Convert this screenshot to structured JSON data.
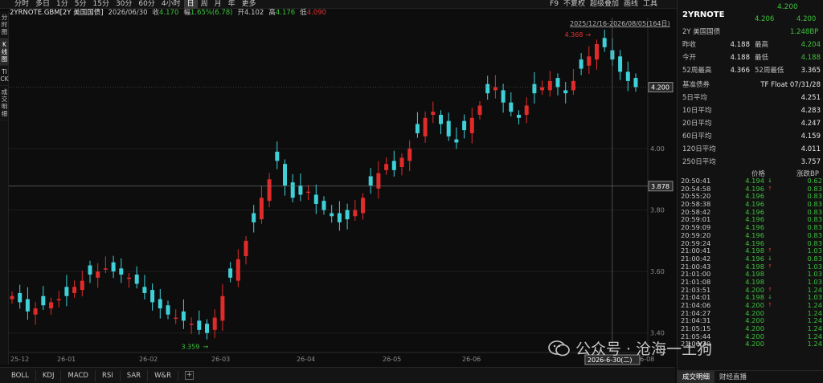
{
  "toolbar": {
    "periods": [
      "分时",
      "多日",
      "1分",
      "5分",
      "15分",
      "30分",
      "60分",
      "4小时",
      "日",
      "周",
      "月",
      "年",
      "更多"
    ],
    "active_period": "日",
    "right_items": [
      "F9",
      "不复权",
      "超级叠加",
      "画线",
      "工具"
    ]
  },
  "info": {
    "symbol": "2YRNOTE.GBM[2Y 美国国债]",
    "date": "2026/06/30",
    "close_label": "收",
    "close": "4.170",
    "change_label": "幅",
    "change": "1.65%(6.78)",
    "open_label": "开",
    "open": "4.102",
    "high_label": "高",
    "high": "4.176",
    "low_label": "低",
    "low": "4.090"
  },
  "leftbar": [
    "分时图",
    "K线图",
    "TICK",
    "成交明细"
  ],
  "leftbar_active": "K线图",
  "chart": {
    "range_label": "2025/12/16-2026/08/05(164日)",
    "max_label": "4.368",
    "min_label": "3.359",
    "current_price_tag": "4.200",
    "crosshair_price_tag": "3.878",
    "crosshair_date_tag": "2026-6-30(二)",
    "x_ticks": [
      "25-12",
      "26-01",
      "26-02",
      "26-03",
      "26-04",
      "26-05",
      "26-06",
      "26-08"
    ],
    "y_ticks": [
      "4.00",
      "3.80",
      "3.60",
      "3.40"
    ],
    "colors": {
      "up": "#e02b2b",
      "down": "#3fd0d8",
      "grid": "#1e1e1e",
      "axis": "#8a8a8a"
    }
  },
  "chart_data": {
    "type": "candlestick",
    "date_range": "2025/12/16-2026/08/05",
    "trading_days": 164,
    "highest": 4.368,
    "lowest": 3.359,
    "ylim": [
      3.36,
      4.4
    ],
    "y_ticks": [
      4.0,
      3.8,
      3.6,
      3.4
    ],
    "x_ticks": [
      "25-12",
      "26-01",
      "26-02",
      "26-03",
      "26-04",
      "26-05",
      "26-06",
      "26-08"
    ],
    "close_path": [
      3.52,
      3.5,
      3.47,
      3.48,
      3.49,
      3.5,
      3.51,
      3.52,
      3.55,
      3.57,
      3.59,
      3.6,
      3.61,
      3.6,
      3.59,
      3.58,
      3.56,
      3.53,
      3.5,
      3.48,
      3.46,
      3.45,
      3.44,
      3.43,
      3.41,
      3.4,
      3.45,
      3.52,
      3.58,
      3.64,
      3.7,
      3.76,
      3.84,
      3.9,
      3.96,
      3.88,
      3.84,
      3.85,
      3.86,
      3.82,
      3.8,
      3.78,
      3.76,
      3.77,
      3.8,
      3.84,
      3.88,
      3.92,
      3.95,
      3.93,
      3.97,
      4.0,
      4.05,
      4.1,
      4.12,
      4.08,
      4.04,
      4.02,
      4.06,
      4.1,
      4.14,
      4.18,
      4.2,
      4.15,
      4.12,
      4.1,
      4.14,
      4.18,
      4.2,
      4.22,
      4.2,
      4.18,
      4.22,
      4.26,
      4.3,
      4.34,
      4.33,
      4.29,
      4.25,
      4.22,
      4.2
    ]
  },
  "panel": {
    "symbol": "2YRNOTE",
    "price": "4.200",
    "price2": "4.206",
    "price3": "4.200",
    "name": "2Y 美国国债",
    "bp_change": "1.248BP",
    "stats": [
      {
        "l1": "昨收",
        "v1": "4.188",
        "l2": "最高",
        "v2": "4.204"
      },
      {
        "l1": "今开",
        "v1": "4.188",
        "l2": "最低",
        "v2": "4.188"
      },
      {
        "l1": "52周最高",
        "v1": "4.366",
        "l2": "52周最低",
        "v2": "3.365"
      }
    ],
    "benchmark_label": "基准债券",
    "benchmark_value": "TF Float 07/31/28",
    "averages": [
      {
        "label": "5日平均",
        "value": "4.251"
      },
      {
        "label": "10日平均",
        "value": "4.283"
      },
      {
        "label": "20日平均",
        "value": "4.247"
      },
      {
        "label": "60日平均",
        "value": "4.159"
      },
      {
        "label": "120日平均",
        "value": "4.011"
      },
      {
        "label": "250日平均",
        "value": "3.757"
      }
    ],
    "trades_header_price": "价格",
    "trades_header_bp": "涨跌BP",
    "trades": [
      {
        "t": "20:50:41",
        "p": "4.194",
        "a": "down",
        "bp": "0.62"
      },
      {
        "t": "20:54:58",
        "p": "4.196",
        "a": "up",
        "bp": "0.83"
      },
      {
        "t": "20:55:20",
        "p": "4.196",
        "a": "",
        "bp": "0.83"
      },
      {
        "t": "20:58:38",
        "p": "4.196",
        "a": "",
        "bp": "0.83"
      },
      {
        "t": "20:58:42",
        "p": "4.196",
        "a": "",
        "bp": "0.83"
      },
      {
        "t": "20:59:01",
        "p": "4.196",
        "a": "",
        "bp": "0.83"
      },
      {
        "t": "20:59:09",
        "p": "4.196",
        "a": "",
        "bp": "0.83"
      },
      {
        "t": "20:59:20",
        "p": "4.196",
        "a": "",
        "bp": "0.83"
      },
      {
        "t": "20:59:24",
        "p": "4.196",
        "a": "",
        "bp": "0.83"
      },
      {
        "t": "21:00:41",
        "p": "4.198",
        "a": "up",
        "bp": "1.03"
      },
      {
        "t": "21:00:42",
        "p": "4.196",
        "a": "down",
        "bp": "0.83"
      },
      {
        "t": "21:00:43",
        "p": "4.198",
        "a": "up",
        "bp": "1.03"
      },
      {
        "t": "21:01:00",
        "p": "4.198",
        "a": "",
        "bp": "1.03"
      },
      {
        "t": "21:01:08",
        "p": "4.198",
        "a": "",
        "bp": "1.03"
      },
      {
        "t": "21:03:51",
        "p": "4.200",
        "a": "up",
        "bp": "1.24"
      },
      {
        "t": "21:04:01",
        "p": "4.198",
        "a": "down",
        "bp": "1.03"
      },
      {
        "t": "21:04:06",
        "p": "4.200",
        "a": "up",
        "bp": "1.24"
      },
      {
        "t": "21:04:27",
        "p": "4.200",
        "a": "",
        "bp": "1.24"
      },
      {
        "t": "21:04:31",
        "p": "4.200",
        "a": "",
        "bp": "1.24"
      },
      {
        "t": "21:05:15",
        "p": "4.200",
        "a": "",
        "bp": "1.24"
      },
      {
        "t": "21:05:44",
        "p": "4.200",
        "a": "",
        "bp": "1.24"
      },
      {
        "t": "21:06:30",
        "p": "4.200",
        "a": "",
        "bp": "1.24"
      }
    ],
    "tabs": [
      "成交明细",
      "财经直播"
    ],
    "active_tab": "成交明细"
  },
  "indicators": [
    "BOLL",
    "KDJ",
    "MACD",
    "RSI",
    "SAR",
    "W&R"
  ],
  "watermark": "公众号 · 沧海一土狗"
}
